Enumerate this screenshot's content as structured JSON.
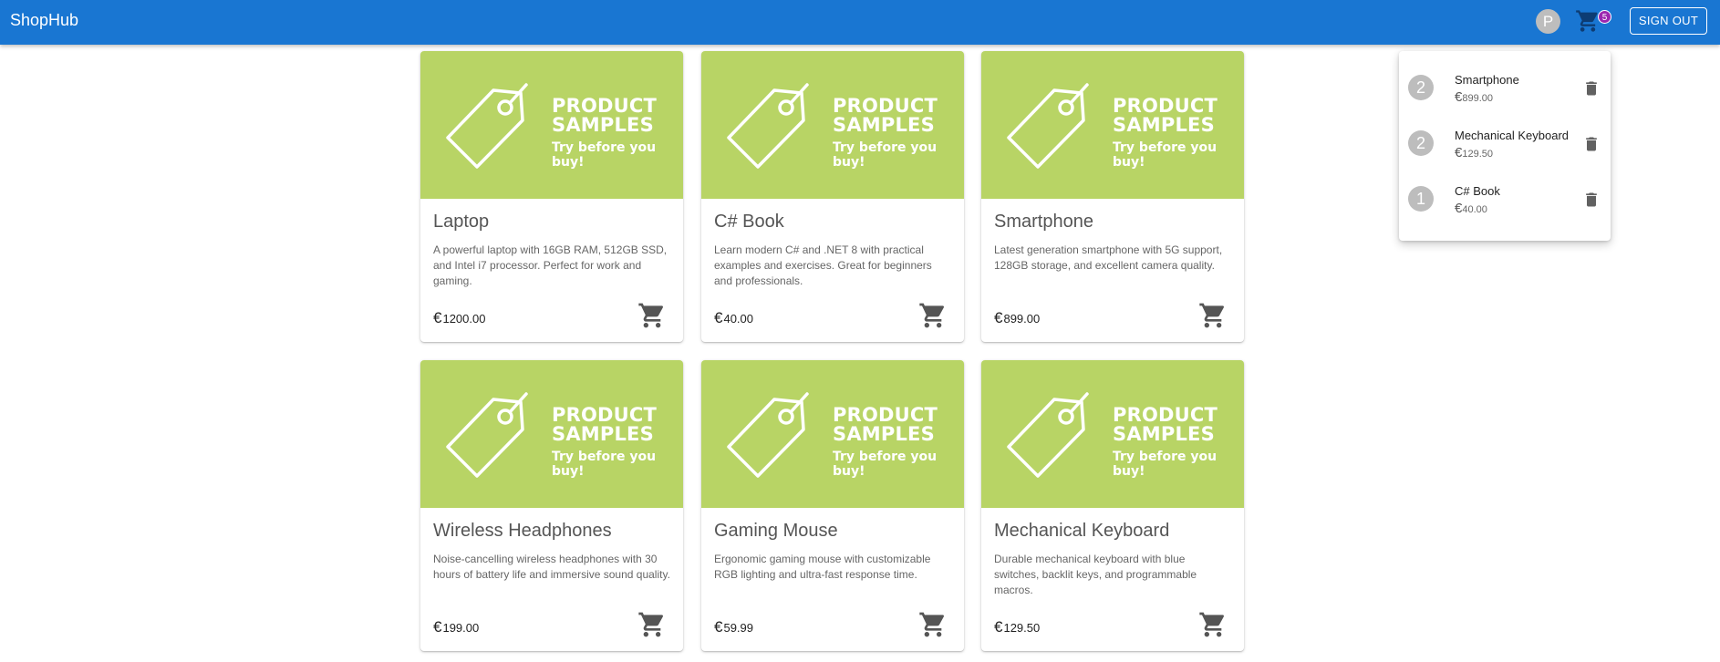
{
  "appbar": {
    "title": "ShopHub",
    "avatar_letter": "P",
    "cart_count": "5",
    "signout_label": "SIGN OUT"
  },
  "currency_symbol": "€",
  "media": {
    "line1": "PRODUCT",
    "line2": "SAMPLES",
    "line3": "Try before you buy!",
    "color": "#b8d465"
  },
  "products": [
    {
      "name": "Laptop",
      "description": "A powerful laptop with 16GB RAM, 512GB SSD, and Intel i7 processor. Perfect for work and gaming.",
      "price": "1200.00"
    },
    {
      "name": "C# Book",
      "description": "Learn modern C# and .NET 8 with practical examples and exercises. Great for beginners and professionals.",
      "price": "40.00"
    },
    {
      "name": "Smartphone",
      "description": "Latest generation smartphone with 5G support, 128GB storage, and excellent camera quality.",
      "price": "899.00"
    },
    {
      "name": "Wireless Headphones",
      "description": "Noise-cancelling wireless headphones with 30 hours of battery life and immersive sound quality.",
      "price": "199.00"
    },
    {
      "name": "Gaming Mouse",
      "description": "Ergonomic gaming mouse with customizable RGB lighting and ultra-fast response time.",
      "price": "59.99"
    },
    {
      "name": "Mechanical Keyboard",
      "description": "Durable mechanical keyboard with blue switches, backlit keys, and programmable macros.",
      "price": "129.50"
    }
  ],
  "cart": {
    "items": [
      {
        "qty": "2",
        "name": "Smartphone",
        "price": "899.00"
      },
      {
        "qty": "2",
        "name": "Mechanical Keyboard",
        "price": "129.50"
      },
      {
        "qty": "1",
        "name": "C# Book",
        "price": "40.00"
      }
    ]
  },
  "icons": {
    "cart": "shopping-cart-icon",
    "delete": "trash-icon",
    "tag": "price-tag-icon"
  },
  "colors": {
    "appbar": "#1976d2",
    "badge": "#9c27b0"
  }
}
